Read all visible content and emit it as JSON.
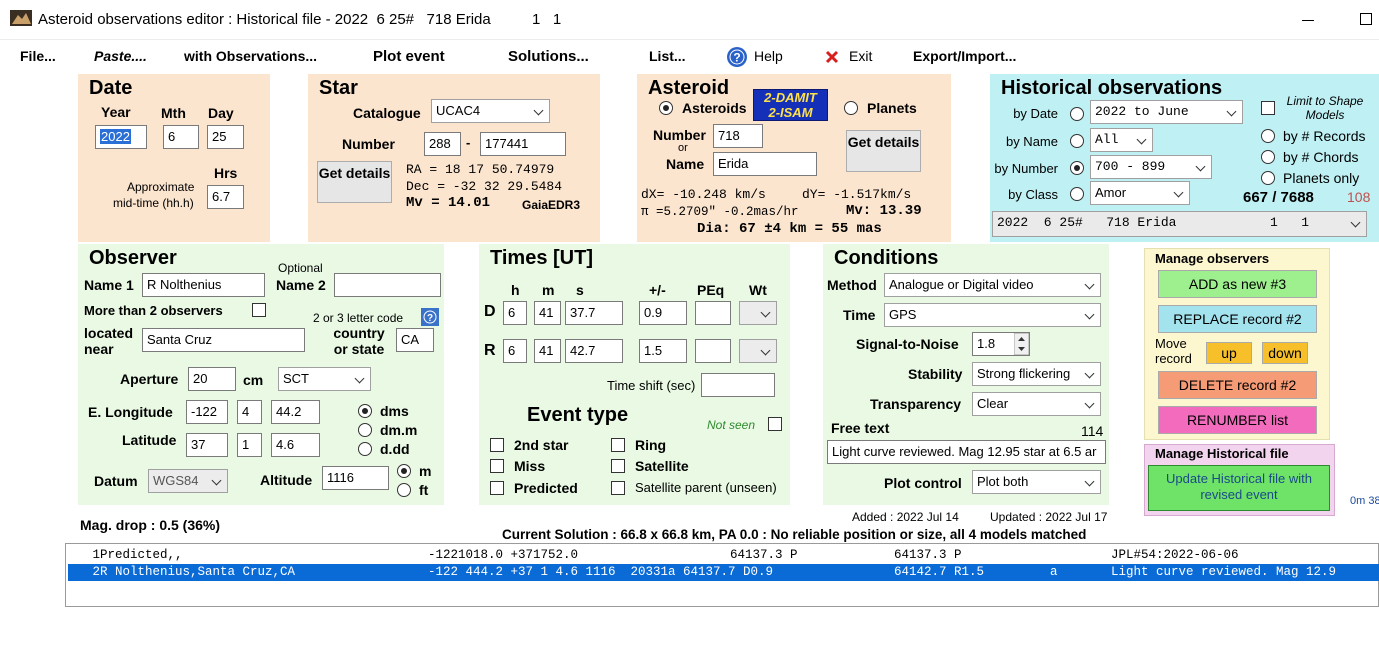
{
  "window": {
    "title": "Asteroid observations editor : Historical file - 2022  6 25#   718 Erida",
    "counter": "1   1"
  },
  "menu": [
    "File...",
    "Paste....",
    "with Observations...",
    "Plot event",
    "Solutions...",
    "List...",
    "Help",
    "Exit",
    "Export/Import..."
  ],
  "date": {
    "title": "Date",
    "year_label": "Year",
    "month_label": "Mth",
    "day_label": "Day",
    "year": "2022",
    "month": "6",
    "day": "25",
    "hrs_label": "Hrs",
    "mid_time_label_1": "Approximate",
    "mid_time_label_2": "mid-time (hh.h)",
    "hrs": "6.7"
  },
  "star": {
    "title": "Star",
    "catalogue_label": "Catalogue",
    "catalogue": "UCAC4",
    "number_label": "Number",
    "number_zone": "288",
    "dash": "-",
    "number": "177441",
    "details_button": "Get details",
    "ra": "RA = 18 17 50.74979",
    "dec": "Dec = -32 32 29.5484",
    "mv": "Mv = 14.01",
    "source": "GaiaEDR3"
  },
  "asteroid": {
    "title": "Asteroid",
    "asteroids_label": "Asteroids",
    "planets_label": "Planets",
    "damit_badge_1": "2-DAMIT",
    "damit_badge_2": "2-ISAM",
    "number_label": "Number",
    "or_label": "or",
    "name_label": "Name",
    "number": "718",
    "name": "Erida",
    "details_button": "Get details",
    "dx": "dX= -10.248 km/s",
    "dy": "dY= -1.517km/s",
    "parallax": "π =5.2709\" -0.2mas/hr",
    "mv": "Mv: 13.39",
    "dia": "Dia: 67 ±4 km = 55 mas"
  },
  "historical": {
    "title": "Historical observations",
    "limit_label": "Limit to Shape Models",
    "by_date_label": "by Date",
    "by_date_value": "2022 to June",
    "by_name_label": "by Name",
    "by_name_value": "All",
    "by_number_label": "by Number",
    "by_number_value": "700 - 899",
    "by_class_label": "by Class",
    "by_class_value": "Amor",
    "sort_records": "by # Records",
    "sort_chords": "by # Chords",
    "planets_only": "Planets only",
    "count": "667 / 7688",
    "count_extra": "108",
    "event_select": "2022  6 25#   718 Erida            1   1"
  },
  "observer": {
    "title": "Observer",
    "name1_label": "Name 1",
    "name1": "R Nolthenius",
    "optional_label": "Optional",
    "name2_label": "Name 2",
    "name2": "",
    "more_than_2": "More than 2 observers",
    "letter_code_hint": "2 or 3 letter code",
    "located_label": "located near",
    "located": "Santa Cruz",
    "country_label": "country or state",
    "country": "CA",
    "aperture_label": "Aperture",
    "aperture": "20",
    "cm_label": "cm",
    "telescope": "SCT",
    "elong_label": "E. Longitude",
    "elong_d": "-122",
    "elong_m": "4",
    "elong_s": "44.2",
    "lat_label": "Latitude",
    "lat_d": "37",
    "lat_m": "1",
    "lat_s": "4.6",
    "fmt_dms": "dms",
    "fmt_dmm": "dm.m",
    "fmt_ddd": "d.dd",
    "datum_label": "Datum",
    "datum": "WGS84",
    "altitude_label": "Altitude",
    "altitude": "1116",
    "unit_m": "m",
    "unit_ft": "ft"
  },
  "times": {
    "title": "Times  [UT]",
    "col_h": "h",
    "col_m": "m",
    "col_s": "s",
    "col_pm": "+/-",
    "col_peq": "PEq",
    "col_wt": "Wt",
    "d_label": "D",
    "d_h": "6",
    "d_m": "41",
    "d_s": "37.7",
    "d_pm": "0.9",
    "r_label": "R",
    "r_h": "6",
    "r_m": "41",
    "r_s": "42.7",
    "r_pm": "1.5",
    "time_shift_label": "Time shift (sec)",
    "event_type_title": "Event type",
    "not_seen": "Not seen",
    "ev_2nd_star": "2nd star",
    "ev_ring": "Ring",
    "ev_miss": "Miss",
    "ev_satellite": "Satellite",
    "ev_predicted": "Predicted",
    "ev_sat_parent": "Satellite parent (unseen)"
  },
  "conditions": {
    "title": "Conditions",
    "method_label": "Method",
    "method": "Analogue or Digital video",
    "time_label": "Time",
    "time": "GPS",
    "snr_label": "Signal-to-Noise",
    "snr": "1.8",
    "stability_label": "Stability",
    "stability": "Strong flickering",
    "transparency_label": "Transparency",
    "transparency": "Clear",
    "free_text_label": "Free text",
    "free_text_count": "114",
    "free_text": "Light curve reviewed. Mag 12.95 star at 6.5 ar",
    "plot_control_label": "Plot control",
    "plot_control": "Plot both"
  },
  "manage_observers": {
    "title": "Manage observers",
    "add": "ADD  as new #3",
    "replace": "REPLACE  record #2",
    "move_record": "Move record",
    "up": "up",
    "down": "down",
    "delete": "DELETE  record #2",
    "renumber": "RENUMBER  list"
  },
  "manage_historical": {
    "title": "Manage Historical file",
    "update": "Update Historical file with revised event"
  },
  "side_text": "0m 38",
  "status": {
    "mag_drop": "Mag. drop : 0.5 (36%)",
    "added": "Added : 2022 Jul 14",
    "updated": "Updated : 2022 Jul 17",
    "solution": "Current Solution : 66.8 x 66.8 km, PA 0.0 : No reliable position or size, all 4 models matched"
  },
  "records": [
    {
      "c1": " 1Predicted,,",
      "c2": "-1221018.0 +371752.0",
      "c3": "64137.3 P",
      "c4": "64137.3 P",
      "c5": "",
      "c6": "JPL#54:2022-06-06",
      "selected": false
    },
    {
      "c1": " 2R Nolthenius,Santa Cruz,CA",
      "c2": "-122 444.2 +37 1 4.6 1116  20331a 64137.7 D0.9",
      "c3": "",
      "c4": "64142.7 R1.5",
      "c5": "a",
      "c6": "Light curve reviewed. Mag 12.9",
      "selected": true
    }
  ],
  "colors": {
    "selection": "#0a6ad6",
    "accent_blue": "#2a6fd6",
    "panel_orange": "#fbe5cf",
    "panel_green": "#e9f9e4",
    "panel_cyan": "#bff0f4"
  }
}
